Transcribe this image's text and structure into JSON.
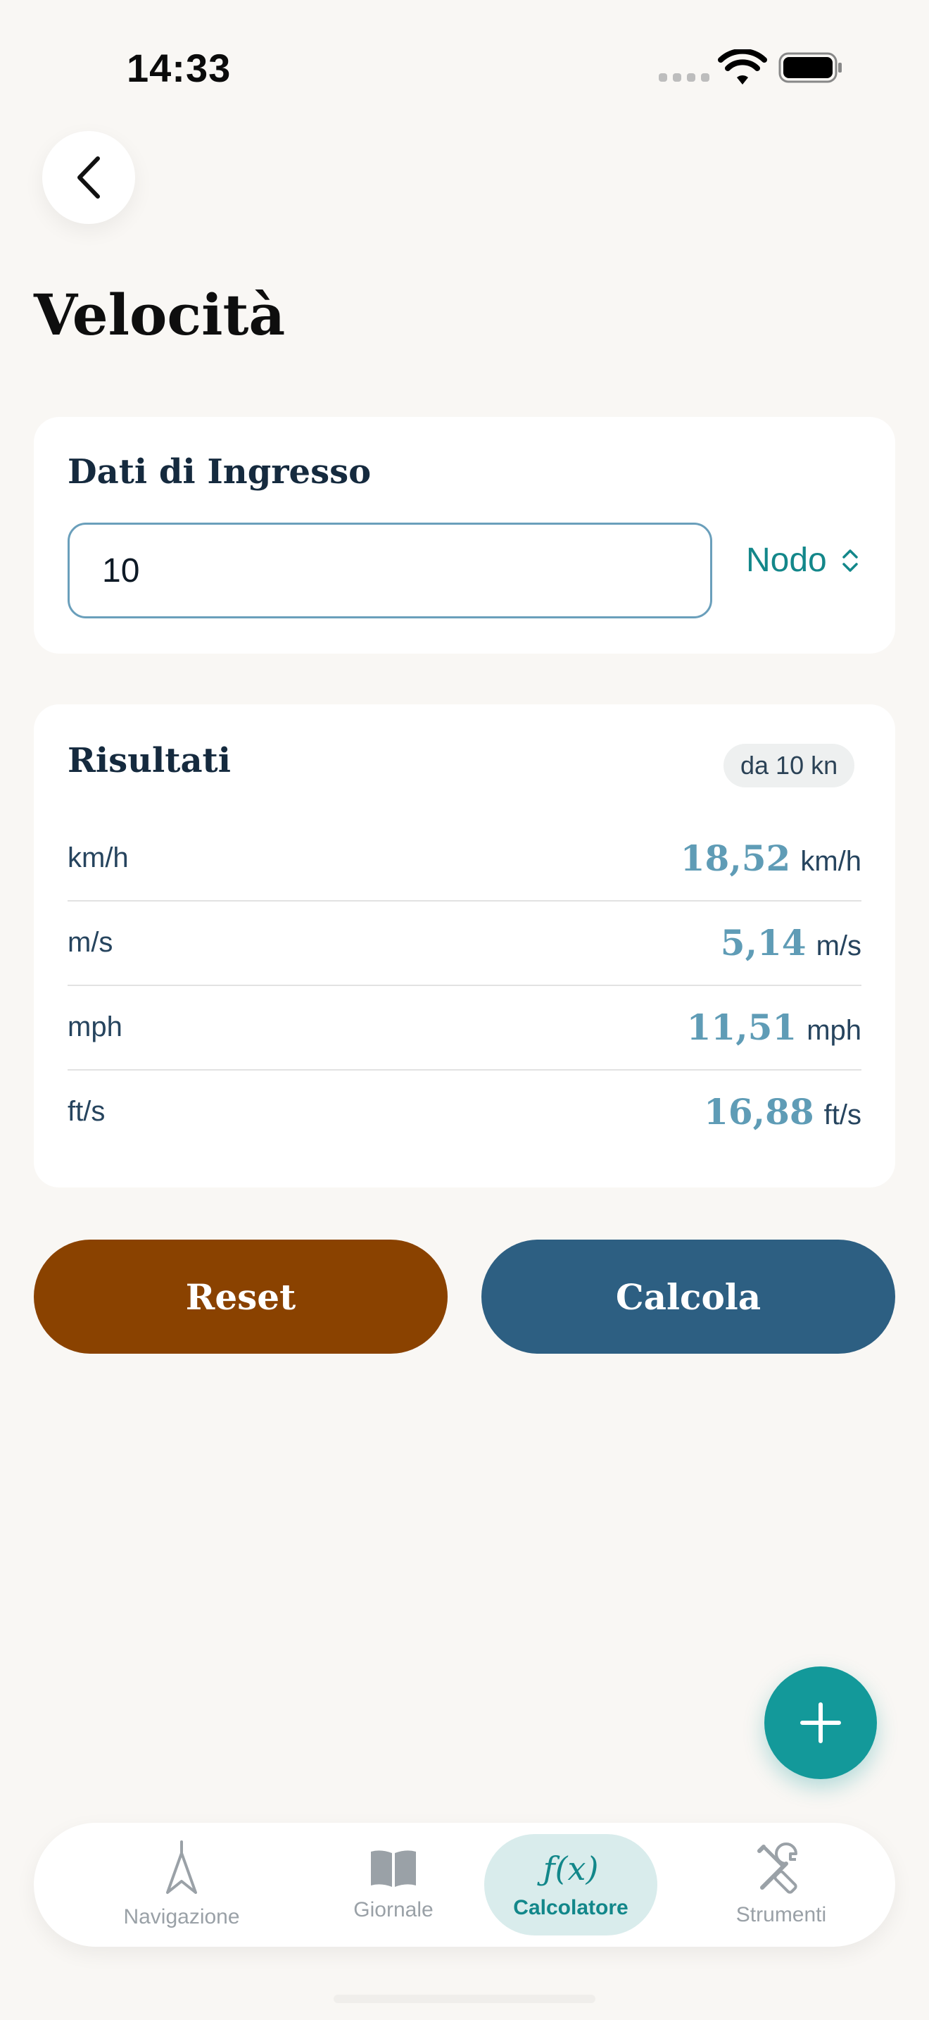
{
  "status_bar": {
    "time": "14:33"
  },
  "page": {
    "title": "Velocità"
  },
  "input_card": {
    "title": "Dati di Ingresso",
    "value": "10",
    "unit": "Nodo"
  },
  "results": {
    "title": "Risultati",
    "badge": "da 10 kn",
    "rows": [
      {
        "label": "km/h",
        "value": "18,52",
        "unit": "km/h"
      },
      {
        "label": "m/s",
        "value": "5,14",
        "unit": "m/s"
      },
      {
        "label": "mph",
        "value": "11,51",
        "unit": "mph"
      },
      {
        "label": "ft/s",
        "value": "16,88",
        "unit": "ft/s"
      }
    ]
  },
  "actions": {
    "reset": "Reset",
    "calculate": "Calcola"
  },
  "tabbar": {
    "items": [
      {
        "label": "Navigazione",
        "icon": "compass-arrow-icon"
      },
      {
        "label": "Giornale",
        "icon": "book-icon"
      },
      {
        "label": "Calcolatore",
        "icon": "function-icon",
        "glyph": "ƒ(x)"
      },
      {
        "label": "Strumenti",
        "icon": "tools-icon"
      }
    ],
    "active": "Calcolatore"
  },
  "colors": {
    "accent": "#13999a",
    "reset_button": "#8a4200",
    "calculate_button": "#2d5f82",
    "result_value": "#5f9cb6"
  }
}
